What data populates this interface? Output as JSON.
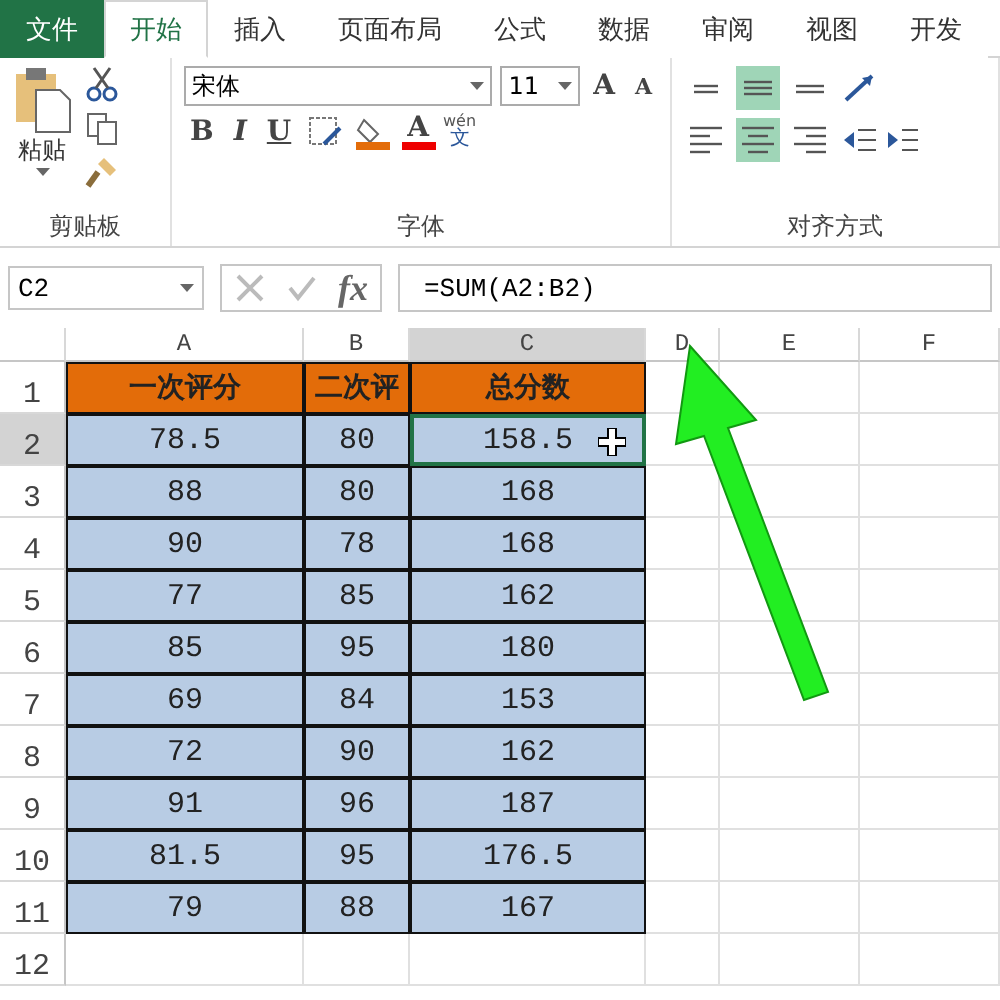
{
  "tabs": [
    {
      "label": "文件",
      "kind": "file",
      "selected": false
    },
    {
      "label": "开始",
      "kind": "tab",
      "selected": true
    },
    {
      "label": "插入",
      "kind": "tab",
      "selected": false
    },
    {
      "label": "页面布局",
      "kind": "tab",
      "selected": false
    },
    {
      "label": "公式",
      "kind": "tab",
      "selected": false
    },
    {
      "label": "数据",
      "kind": "tab",
      "selected": false
    },
    {
      "label": "审阅",
      "kind": "tab",
      "selected": false
    },
    {
      "label": "视图",
      "kind": "tab",
      "selected": false
    },
    {
      "label": "开发",
      "kind": "tab",
      "selected": false
    }
  ],
  "clipboard": {
    "paste_label": "粘贴",
    "group_label": "剪贴板"
  },
  "font": {
    "name": "宋体",
    "size": "11",
    "grow": "A",
    "shrink": "A",
    "bold": "B",
    "italic": "I",
    "underline": "U",
    "font_color_letter": "A",
    "phonetic_top": "wén",
    "phonetic_bottom": "文",
    "group_label": "字体"
  },
  "alignment": {
    "top_row": [
      {
        "kind": "top",
        "selected": false
      },
      {
        "kind": "middle",
        "selected": true
      },
      {
        "kind": "bottom",
        "selected": false
      }
    ],
    "bottom_row": [
      {
        "kind": "left",
        "selected": false
      },
      {
        "kind": "center",
        "selected": true
      },
      {
        "kind": "right",
        "selected": false
      }
    ],
    "group_label": "对齐方式"
  },
  "formula_bar": {
    "name_box": "C2",
    "fx": "fx",
    "formula": "=SUM(A2:B2)"
  },
  "columns": [
    {
      "label": "A",
      "selected": false
    },
    {
      "label": "B",
      "selected": false
    },
    {
      "label": "C",
      "selected": true
    },
    {
      "label": "D",
      "selected": false
    },
    {
      "label": "E",
      "selected": false
    },
    {
      "label": "F",
      "selected": false
    }
  ],
  "rows": [
    {
      "number": "1",
      "kind": "header",
      "selected": false,
      "cells": [
        {
          "text": "一次评分",
          "selected": false
        },
        {
          "text": "二次评",
          "selected": false
        },
        {
          "text": "总分数",
          "selected": false
        }
      ]
    },
    {
      "number": "2",
      "kind": "data",
      "selected": true,
      "cells": [
        {
          "text": "78.5",
          "selected": false
        },
        {
          "text": "80",
          "selected": false
        },
        {
          "text": "158.5",
          "selected": true
        }
      ]
    },
    {
      "number": "3",
      "kind": "data",
      "selected": false,
      "cells": [
        {
          "text": "88",
          "selected": false
        },
        {
          "text": "80",
          "selected": false
        },
        {
          "text": "168",
          "selected": false
        }
      ]
    },
    {
      "number": "4",
      "kind": "data",
      "selected": false,
      "cells": [
        {
          "text": "90",
          "selected": false
        },
        {
          "text": "78",
          "selected": false
        },
        {
          "text": "168",
          "selected": false
        }
      ]
    },
    {
      "number": "5",
      "kind": "data",
      "selected": false,
      "cells": [
        {
          "text": "77",
          "selected": false
        },
        {
          "text": "85",
          "selected": false
        },
        {
          "text": "162",
          "selected": false
        }
      ]
    },
    {
      "number": "6",
      "kind": "data",
      "selected": false,
      "cells": [
        {
          "text": "85",
          "selected": false
        },
        {
          "text": "95",
          "selected": false
        },
        {
          "text": "180",
          "selected": false
        }
      ]
    },
    {
      "number": "7",
      "kind": "data",
      "selected": false,
      "cells": [
        {
          "text": "69",
          "selected": false
        },
        {
          "text": "84",
          "selected": false
        },
        {
          "text": "153",
          "selected": false
        }
      ]
    },
    {
      "number": "8",
      "kind": "data",
      "selected": false,
      "cells": [
        {
          "text": "72",
          "selected": false
        },
        {
          "text": "90",
          "selected": false
        },
        {
          "text": "162",
          "selected": false
        }
      ]
    },
    {
      "number": "9",
      "kind": "data",
      "selected": false,
      "cells": [
        {
          "text": "91",
          "selected": false
        },
        {
          "text": "96",
          "selected": false
        },
        {
          "text": "187",
          "selected": false
        }
      ]
    },
    {
      "number": "10",
      "kind": "data",
      "selected": false,
      "cells": [
        {
          "text": "81.5",
          "selected": false
        },
        {
          "text": "95",
          "selected": false
        },
        {
          "text": "176.5",
          "selected": false
        }
      ]
    },
    {
      "number": "11",
      "kind": "data",
      "selected": false,
      "cells": [
        {
          "text": "79",
          "selected": false
        },
        {
          "text": "88",
          "selected": false
        },
        {
          "text": "167",
          "selected": false
        }
      ]
    },
    {
      "number": "12",
      "kind": "empty",
      "selected": false,
      "cells": []
    }
  ]
}
